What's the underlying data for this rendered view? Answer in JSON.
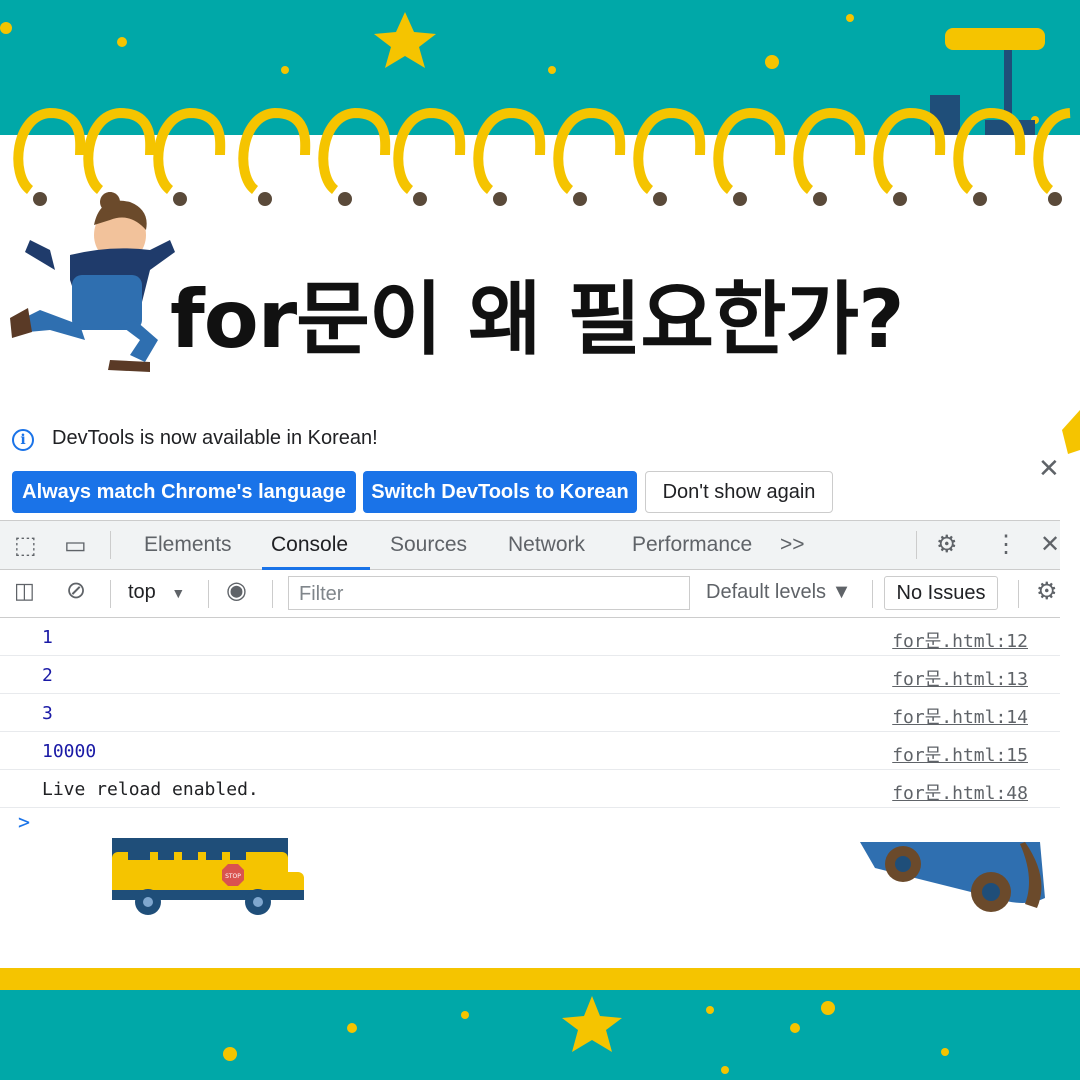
{
  "title": "for문이 왜 필요한가?",
  "colors": {
    "teal": "#00a8a8",
    "yellow": "#f5c400",
    "blue": "#1a73e8"
  },
  "infobar": {
    "message": "DevTools is now available in Korean!",
    "btn_match": "Always match Chrome's language",
    "btn_switch": "Switch DevTools to Korean",
    "btn_dismiss": "Don't show again"
  },
  "tabs": {
    "elements": "Elements",
    "console": "Console",
    "sources": "Sources",
    "network": "Network",
    "performance": "Performance",
    "more": ">>"
  },
  "filterbar": {
    "context": "top",
    "filter_placeholder": "Filter",
    "levels": "Default levels ▼",
    "issues": "No Issues"
  },
  "console": {
    "rows": [
      {
        "value": "1",
        "source": "for문.html:12"
      },
      {
        "value": "2",
        "source": "for문.html:13"
      },
      {
        "value": "3",
        "source": "for문.html:14"
      },
      {
        "value": "10000",
        "source": "for문.html:15"
      },
      {
        "value": "Live reload enabled.",
        "source": "for문.html:48"
      }
    ],
    "prompt": ">"
  },
  "bus_sign": "STOP"
}
